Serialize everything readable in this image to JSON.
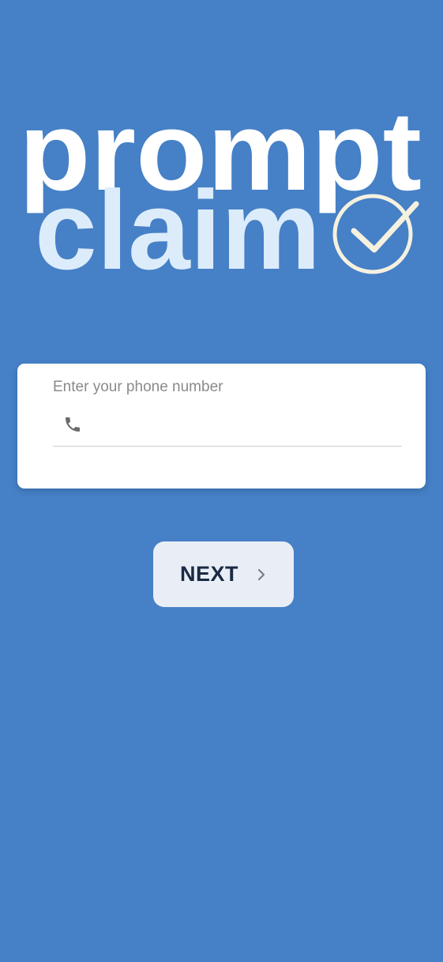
{
  "logo": {
    "line1": "prompt",
    "line2": "claim",
    "icon": "check-circle-icon"
  },
  "form": {
    "label": "Enter your phone number",
    "phone_value": "",
    "phone_icon": "phone-icon"
  },
  "next_button": {
    "label": "NEXT",
    "icon": "chevron-right-icon"
  },
  "colors": {
    "background": "#4680c6",
    "logo_primary": "#ffffff",
    "logo_secondary": "#dcecfb",
    "check": "#f5f1df",
    "button_bg": "#e9eef6",
    "button_text": "#1a2a44"
  }
}
